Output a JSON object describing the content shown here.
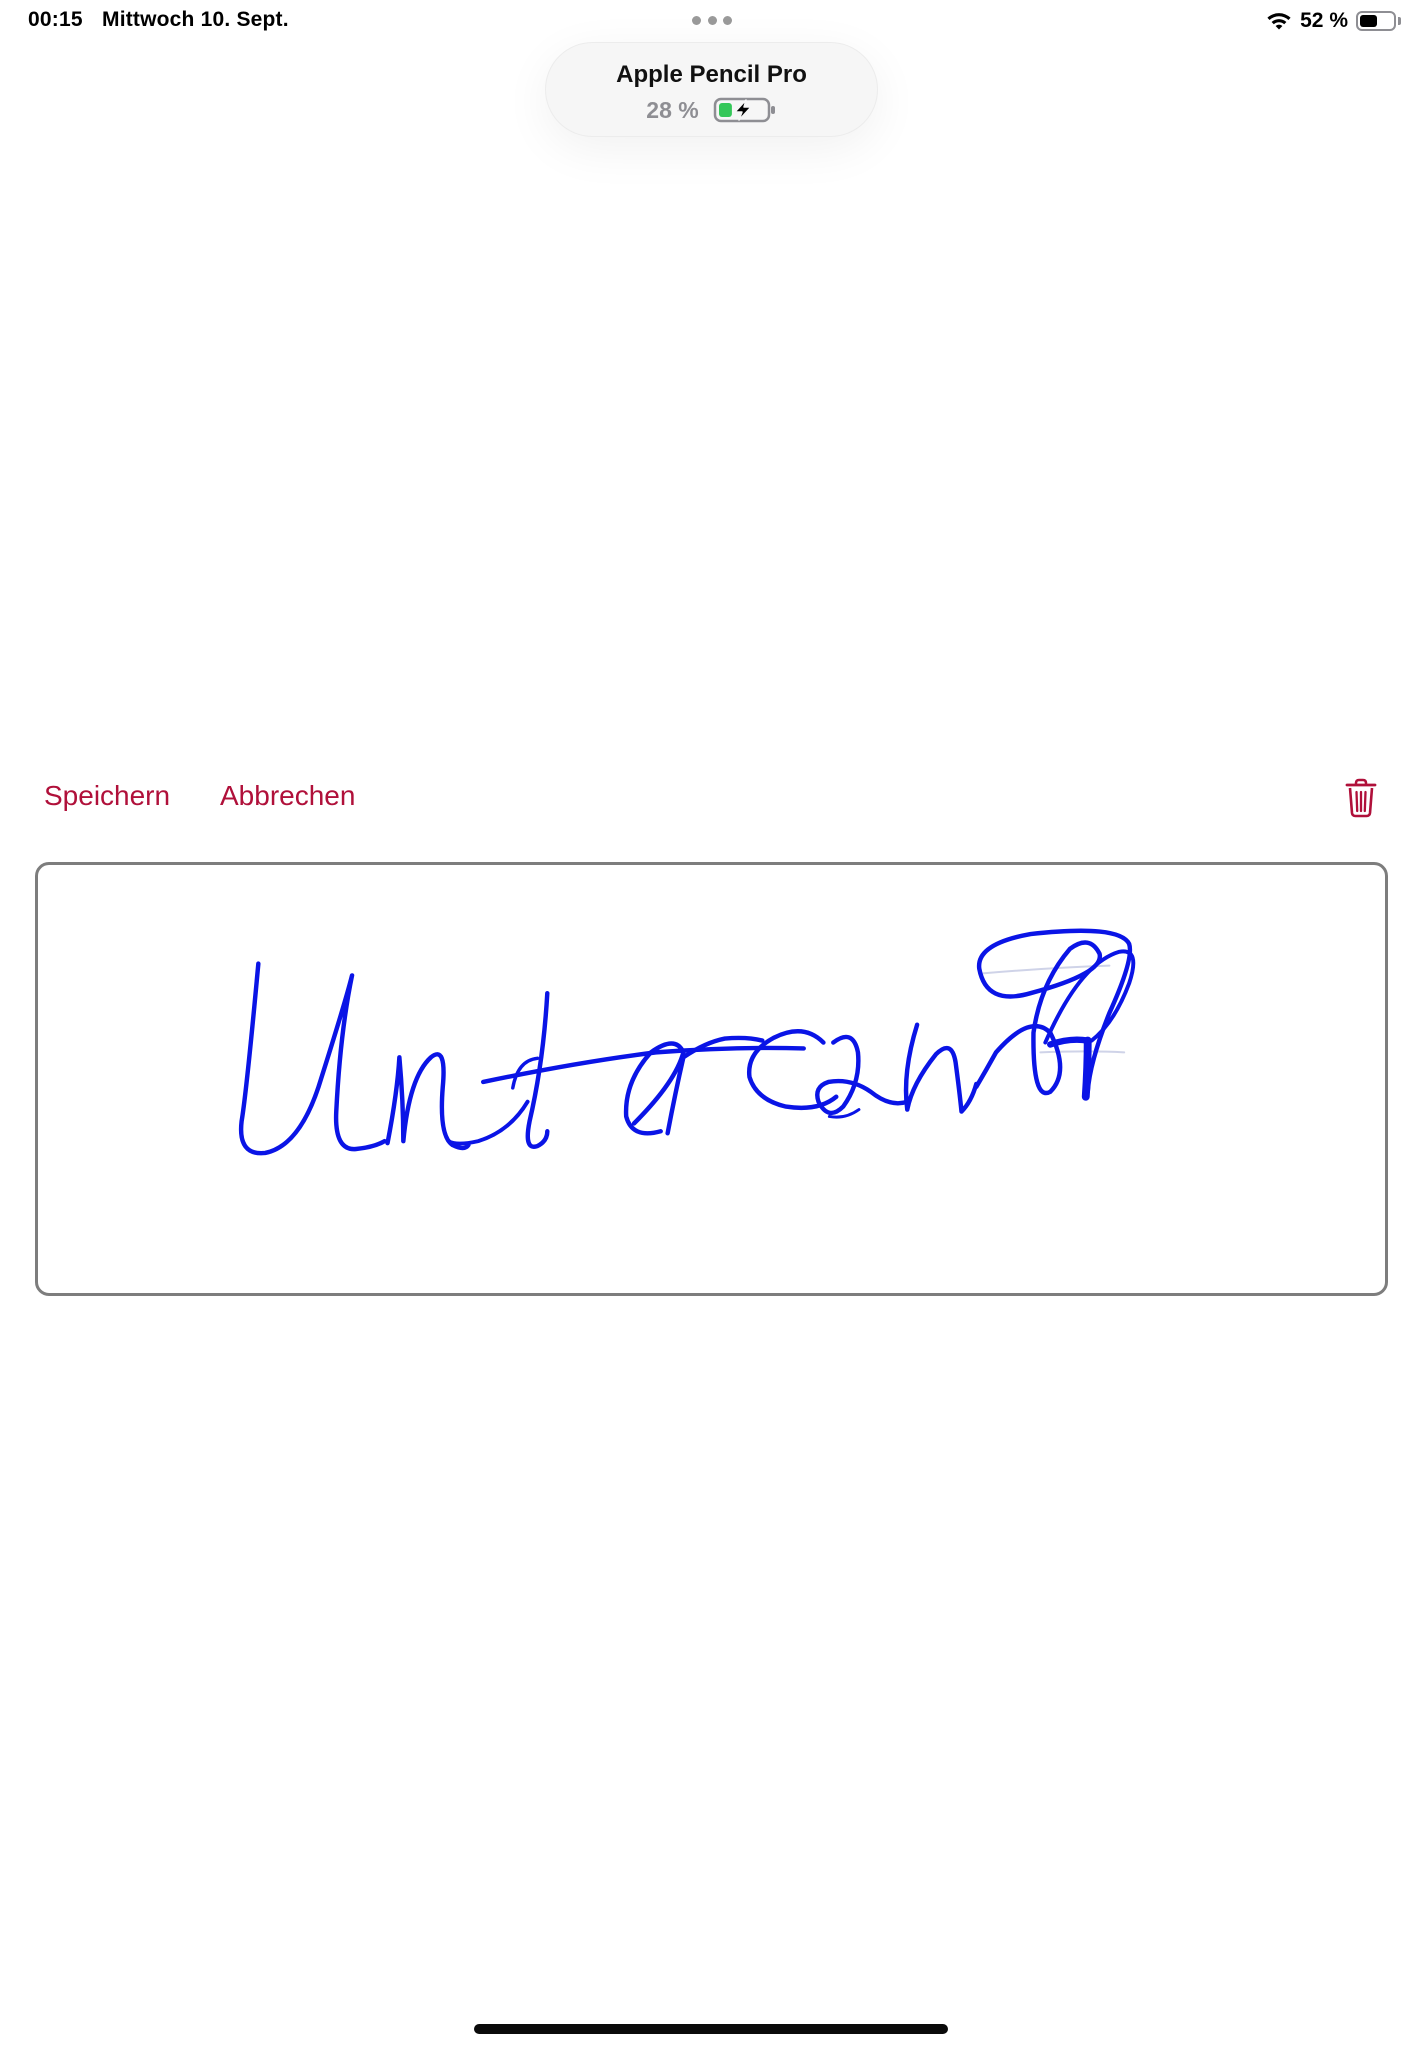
{
  "status_bar": {
    "time": "00:15",
    "date": "Mittwoch 10. Sept.",
    "battery_percent": "52 %",
    "battery_level": 0.52,
    "wifi_icon": "wifi-icon",
    "battery_icon": "battery-icon"
  },
  "pencil_popup": {
    "device_name": "Apple Pencil Pro",
    "battery_percent": "28 %",
    "battery_level": 0.28,
    "charging": true,
    "battery_icon": "charging-battery-icon",
    "battery_color": "#34c759"
  },
  "toolbar": {
    "save_label": "Speichern",
    "cancel_label": "Abbrechen",
    "delete_icon": "trash-icon",
    "accent_color": "#b0103a"
  },
  "signature": {
    "ink_color": "#0a14e6",
    "border_color": "#7d7d7d"
  }
}
